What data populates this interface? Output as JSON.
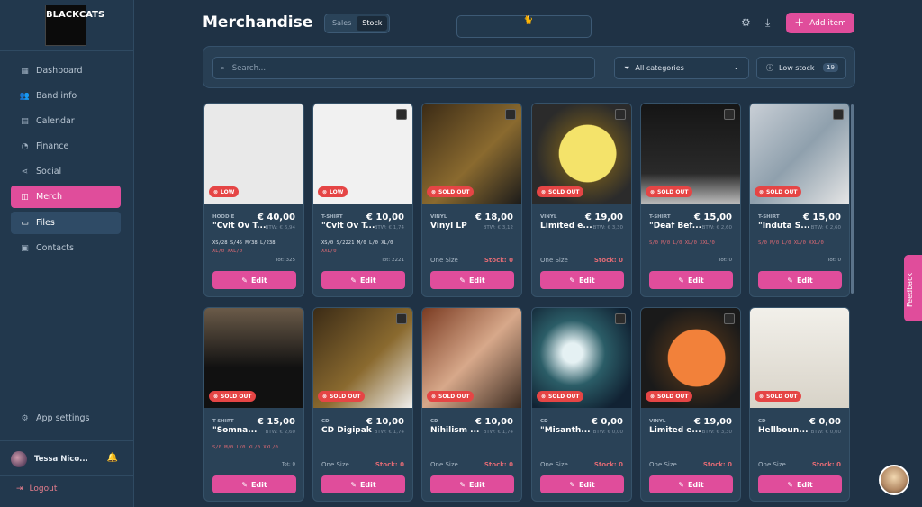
{
  "sidebar": {
    "logo_text": "BLACK CATS",
    "items": [
      {
        "label": "Dashboard",
        "icon": "grid-icon"
      },
      {
        "label": "Band info",
        "icon": "users-icon"
      },
      {
        "label": "Calendar",
        "icon": "calendar-icon"
      },
      {
        "label": "Finance",
        "icon": "piggy-bank-icon"
      },
      {
        "label": "Social",
        "icon": "share-icon"
      },
      {
        "label": "Merch",
        "icon": "shopping-bag-icon"
      },
      {
        "label": "Files",
        "icon": "folder-icon"
      },
      {
        "label": "Contacts",
        "icon": "address-book-icon"
      }
    ],
    "settings": "App settings",
    "user": "Tessa Nico...",
    "logout": "Logout"
  },
  "header": {
    "title": "Merchandise",
    "toggle": {
      "sales": "Sales",
      "stock": "Stock"
    },
    "add_item": "Add item"
  },
  "filters": {
    "search_placeholder": "Search...",
    "category": "All categories",
    "low_stock": "Low stock",
    "low_stock_count": "19"
  },
  "cards": [
    {
      "category": "HOODIE",
      "name": "\"Cvlt Ov T...",
      "price": "€ 40,00",
      "btw": "BTW: € 6,94",
      "badge": "LOW",
      "sizes_line1": "XS/28 S/45 M/38 L/238",
      "sizes_line2": "XL/0 XXL/0",
      "total": "Tot: 325",
      "edit": "Edit"
    },
    {
      "category": "T-SHIRT",
      "name": "\"Cvlt Ov T...",
      "price": "€ 10,00",
      "btw": "BTW: € 1,74",
      "badge": "LOW",
      "sizes_line1": "XS/0 S/2221 M/0 L/0 XL/0",
      "sizes_line2": "XXL/0",
      "total": "Tot: 2221",
      "edit": "Edit"
    },
    {
      "category": "VINYL",
      "name": "Vinyl LP",
      "price": "€ 18,00",
      "btw": "BTW: € 3,12",
      "badge": "SOLD OUT",
      "one_size": "One Size",
      "stock": "Stock: 0",
      "edit": "Edit"
    },
    {
      "category": "VINYL",
      "name": "Limited e...",
      "price": "€ 19,00",
      "btw": "BTW: € 3,30",
      "badge": "SOLD OUT",
      "one_size": "One Size",
      "stock": "Stock: 0",
      "edit": "Edit"
    },
    {
      "category": "T-SHIRT",
      "name": "\"Deaf Bef...",
      "price": "€ 15,00",
      "btw": "BTW: € 2,60",
      "badge": "SOLD OUT",
      "sizes_line1": "S/0 M/0 L/0 XL/0 XXL/0",
      "sizes_line2": "",
      "total": "Tot: 0",
      "edit": "Edit"
    },
    {
      "category": "T-SHIRT",
      "name": "\"Induta S...",
      "price": "€ 15,00",
      "btw": "BTW: € 2,60",
      "badge": "SOLD OUT",
      "sizes_line1": "S/0 M/0 L/0 XL/0 XXL/0",
      "sizes_line2": "",
      "total": "Tot: 0",
      "edit": "Edit"
    },
    {
      "category": "T-SHIRT",
      "name": "\"Somna...",
      "price": "€ 15,00",
      "btw": "BTW: € 2,60",
      "badge": "SOLD OUT",
      "sizes_line1": "S/0 M/0 L/0 XL/0 XXL/0",
      "sizes_line2": "",
      "total": "Tot: 0",
      "edit": "Edit"
    },
    {
      "category": "CD",
      "name": "CD Digipak",
      "price": "€ 10,00",
      "btw": "BTW: € 1,74",
      "badge": "SOLD OUT",
      "one_size": "One Size",
      "stock": "Stock: 0",
      "edit": "Edit"
    },
    {
      "category": "CD",
      "name": "Nihilism ...",
      "price": "€ 10,00",
      "btw": "BTW: € 1,74",
      "badge": "SOLD OUT",
      "one_size": "One Size",
      "stock": "Stock: 0",
      "edit": "Edit"
    },
    {
      "category": "CD",
      "name": "\"Misanth...",
      "price": "€ 0,00",
      "btw": "BTW: € 0,00",
      "badge": "SOLD OUT",
      "one_size": "One Size",
      "stock": "Stock: 0",
      "edit": "Edit"
    },
    {
      "category": "VINYL",
      "name": "Limited e...",
      "price": "€ 19,00",
      "btw": "BTW: € 3,30",
      "badge": "SOLD OUT",
      "one_size": "One Size",
      "stock": "Stock: 0",
      "edit": "Edit"
    },
    {
      "category": "CD",
      "name": "Hellboun...",
      "price": "€ 0,00",
      "btw": "BTW: € 0,00",
      "badge": "SOLD OUT",
      "one_size": "One Size",
      "stock": "Stock: 0",
      "edit": "Edit"
    }
  ],
  "feedback": "Feedback",
  "colors": {
    "accent": "#e04d9b",
    "background": "#1f3245",
    "card": "#2a4257",
    "danger": "#e54545"
  }
}
